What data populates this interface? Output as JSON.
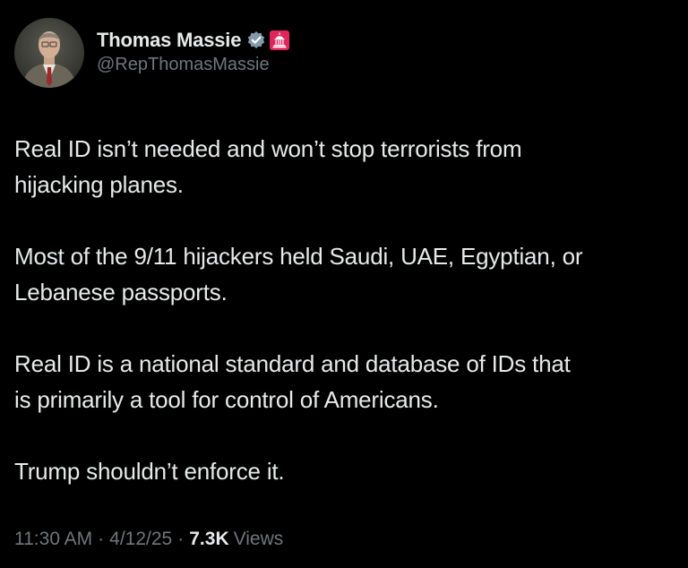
{
  "author": {
    "display_name": "Thomas Massie",
    "handle": "@RepThomasMassie",
    "verified_badge": "verified-checkmark-icon",
    "affiliation_badge": "capitol-building-icon",
    "verified_color": "#e7e9ea",
    "affiliation_color": "#e0245e"
  },
  "tweet": {
    "paragraphs": [
      "Real ID isn’t needed and won’t stop terrorists from\nhijacking planes.",
      "Most of the 9/11 hijackers held Saudi, UAE, Egyptian, or\nLebanese passports.",
      "Real ID is a national standard and database of IDs that\nis primarily a tool for control of Americans.",
      "Trump shouldn’t enforce it."
    ]
  },
  "meta": {
    "time": "11:30 AM",
    "separator": "·",
    "date": "4/12/25",
    "views_count": "7.3K",
    "views_label": "Views"
  },
  "colors": {
    "background": "#000000",
    "primary_text": "#e7e9ea",
    "secondary_text": "#71767b"
  }
}
